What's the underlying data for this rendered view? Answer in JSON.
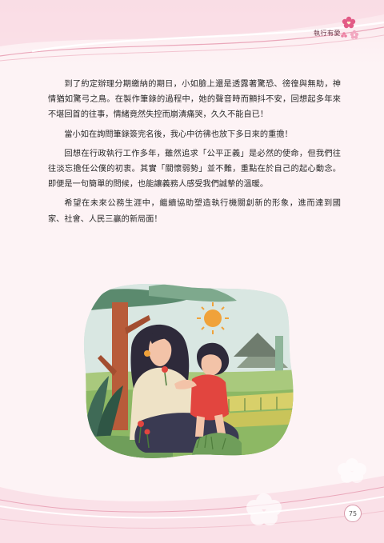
{
  "header": {
    "section_title": "執行有愛"
  },
  "article": {
    "paragraphs": [
      "到了約定辦理分期繳納的期日，小如臉上還是透露著驚恐、徬徨與無助，神情猶如驚弓之鳥。在製作筆錄的過程中，她的聲音時而顫抖不安，回想起多年來不堪回首的往事，情緒竟然失控而崩潰痛哭，久久不能自已！",
      "當小如在詢問筆錄簽完名後，我心中彷彿也放下多日來的重擔！",
      "回想在行政執行工作多年，雖然追求「公平正義」是必然的使命，但我們往往淡忘擔任公僕的初衷。其實「關懷弱勢」並不難，重點在於自己的起心動念。即便是一句簡單的問候，也能讓義務人感受我們誠摯的溫暖。",
      "希望在未來公務生涯中，繼續協助塑造執行機關創新的形象，進而達到國家、社會、人民三贏的新局面！"
    ]
  },
  "illustration": {
    "icon": "mother-child-illustration"
  },
  "footer": {
    "page_number": "75"
  },
  "colors": {
    "background": "#fdf3f5",
    "accent_pink": "#e8a3b6",
    "sun": "#f0a23a",
    "tree": "#b85c3a",
    "hair": "#2e2a3a",
    "girl_dress": "#e2453f"
  }
}
